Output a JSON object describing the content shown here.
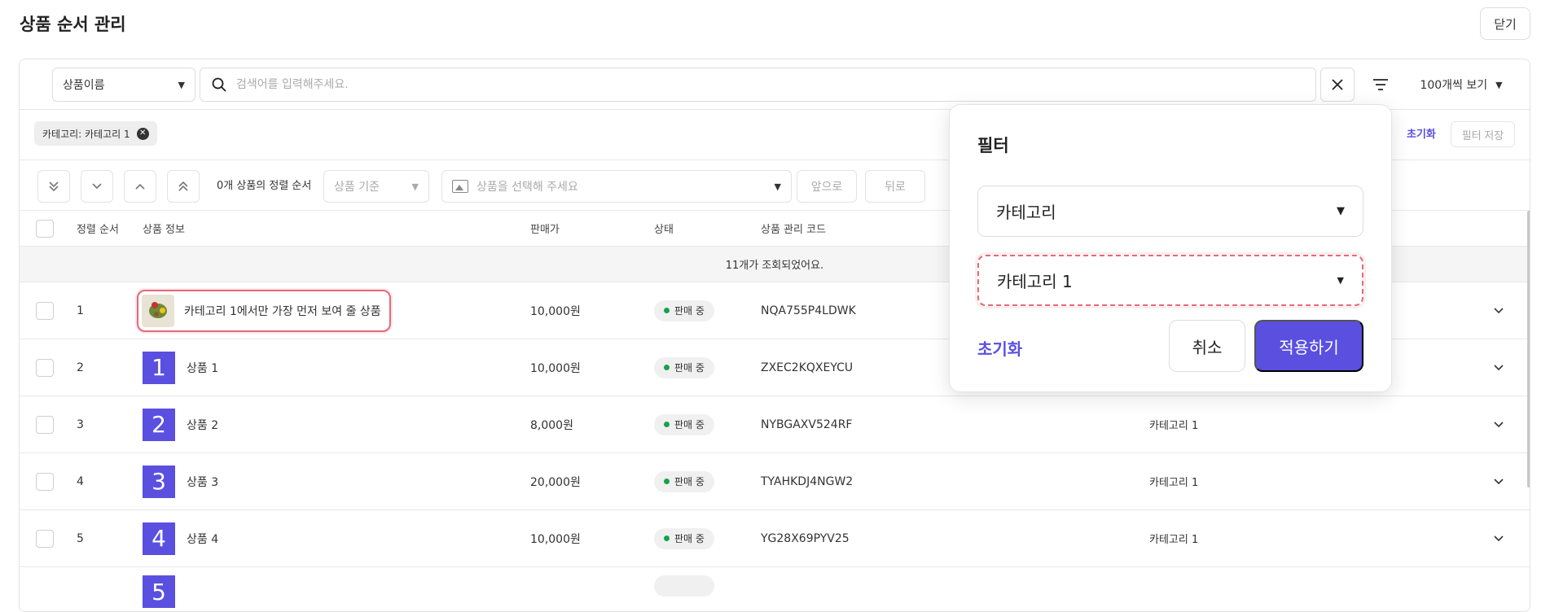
{
  "header": {
    "title": "상품 순서 관리",
    "close_label": "닫기"
  },
  "search": {
    "field_label": "상품이름",
    "placeholder": "검색어를 입력해주세요.",
    "per_page_label": "100개씩 보기"
  },
  "filter_chips": [
    {
      "label": "카테고리: 카테고리 1"
    }
  ],
  "filter_actions": {
    "reset": "초기화",
    "save": "필터 저장"
  },
  "sort_bar": {
    "selected_count_label": "0개 상품의 정렬 순서",
    "basis_placeholder": "상품 기준",
    "product_placeholder": "상품을 선택해 주세요",
    "front_label": "앞으로",
    "back_label": "뒤로"
  },
  "table": {
    "columns": [
      "정렬 순서",
      "상품 정보",
      "판매가",
      "상태",
      "상품 관리 코드"
    ],
    "count_text": "11개가 조회되었어요.",
    "rows": [
      {
        "order": "1",
        "thumb": "",
        "name": "카테고리 1에서만 가장 먼저 보여 줄 상품",
        "price": "10,000원",
        "status": "판매 중",
        "code": "NQA755P4LDWK",
        "category": ""
      },
      {
        "order": "2",
        "thumb": "1",
        "name": "상품 1",
        "price": "10,000원",
        "status": "판매 중",
        "code": "ZXEC2KQXEYCU",
        "category": ""
      },
      {
        "order": "3",
        "thumb": "2",
        "name": "상품 2",
        "price": "8,000원",
        "status": "판매 중",
        "code": "NYBGAXV524RF",
        "category": "카테고리 1"
      },
      {
        "order": "4",
        "thumb": "3",
        "name": "상품 3",
        "price": "20,000원",
        "status": "판매 중",
        "code": "TYAHKDJ4NGW2",
        "category": "카테고리 1"
      },
      {
        "order": "5",
        "thumb": "4",
        "name": "상품 4",
        "price": "10,000원",
        "status": "판매 중",
        "code": "YG28X69PYV25",
        "category": "카테고리 1"
      },
      {
        "order": "",
        "thumb": "5",
        "name": "",
        "price": "",
        "status": "",
        "code": "",
        "category": ""
      }
    ]
  },
  "filter_popover": {
    "title": "필터",
    "field_value": "카테고리",
    "value_value": "카테고리 1",
    "reset": "초기화",
    "cancel": "취소",
    "apply": "적용하기"
  },
  "colors": {
    "accent": "#5b4fe0",
    "highlight": "#e46a7a",
    "status_green": "#16a34a"
  }
}
